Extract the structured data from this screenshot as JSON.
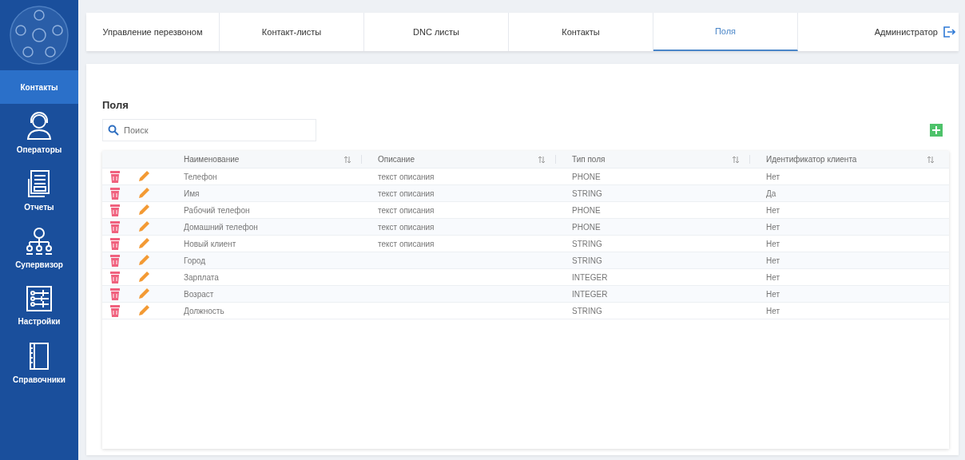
{
  "sidebar": {
    "items": [
      {
        "label": "Контакты",
        "kind": "contacts",
        "selected": true
      },
      {
        "label": "Операторы",
        "kind": "operators",
        "selected": false
      },
      {
        "label": "Отчеты",
        "kind": "reports",
        "selected": false
      },
      {
        "label": "Супервизор",
        "kind": "supervisor",
        "selected": false
      },
      {
        "label": "Настройки",
        "kind": "settings",
        "selected": false
      },
      {
        "label": "Справочники",
        "kind": "directory",
        "selected": false
      }
    ]
  },
  "tabs": [
    {
      "label": "Управление перезвоном",
      "selected": false
    },
    {
      "label": "Контакт-листы",
      "selected": false
    },
    {
      "label": "DNC листы",
      "selected": false
    },
    {
      "label": "Контакты",
      "selected": false
    },
    {
      "label": "Поля",
      "selected": true
    }
  ],
  "user": "Администратор",
  "page_title": "Поля",
  "search": {
    "placeholder": "Поиск"
  },
  "table": {
    "columns": [
      "Наименование",
      "Описание",
      "Тип поля",
      "Идентификатор клиента"
    ],
    "rows": [
      {
        "cells": [
          "Телефон",
          "текст описания",
          "PHONE",
          "Нет"
        ]
      },
      {
        "cells": [
          "Имя",
          "текст описания",
          "STRING",
          "Да"
        ]
      },
      {
        "cells": [
          "Рабочий телефон",
          "текст описания",
          "PHONE",
          "Нет"
        ]
      },
      {
        "cells": [
          "Домашний телефон",
          "текст описания",
          "PHONE",
          "Нет"
        ]
      },
      {
        "cells": [
          "Новый клиент",
          "текст описания",
          "STRING",
          "Нет"
        ]
      },
      {
        "cells": [
          "Город",
          "",
          "STRING",
          "Нет"
        ]
      },
      {
        "cells": [
          "Зарплата",
          "",
          "INTEGER",
          "Нет"
        ]
      },
      {
        "cells": [
          "Возраст",
          "",
          "INTEGER",
          "Нет"
        ]
      },
      {
        "cells": [
          "Должность",
          "",
          "STRING",
          "Нет"
        ]
      }
    ]
  }
}
